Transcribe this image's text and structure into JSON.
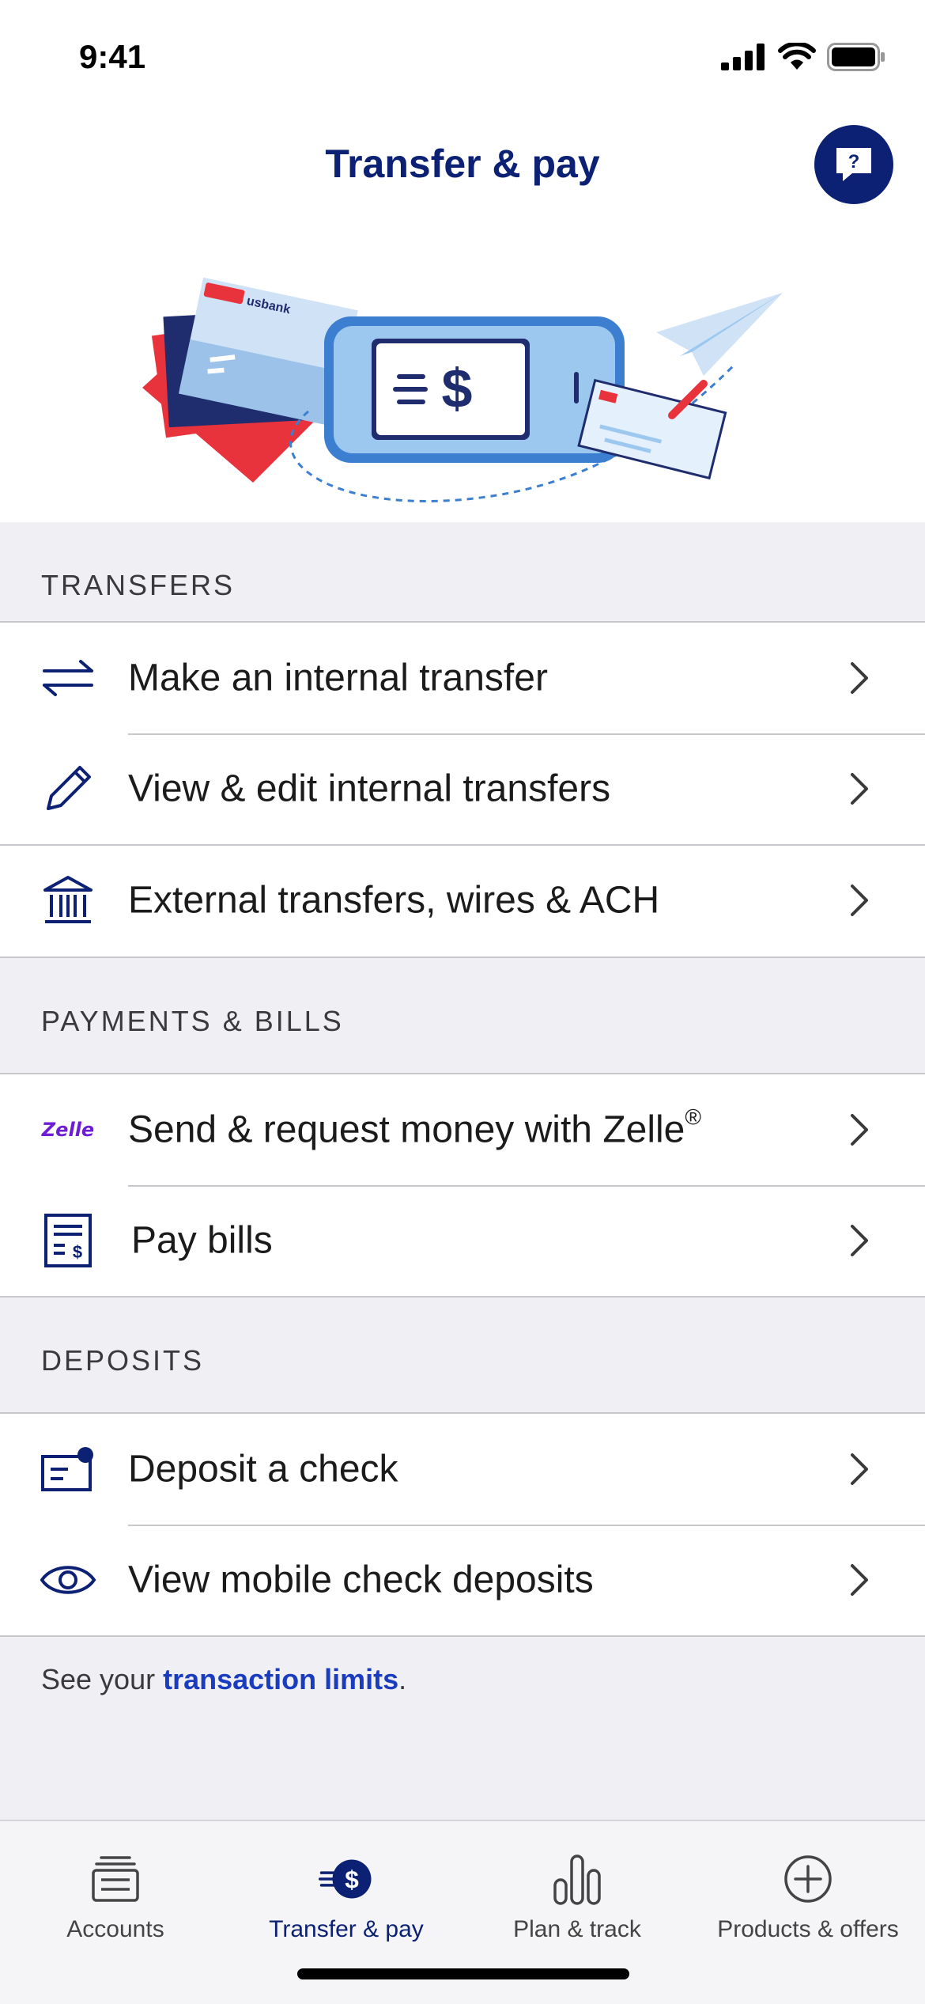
{
  "status_bar": {
    "time": "9:41"
  },
  "header": {
    "title": "Transfer & pay",
    "help_icon_text": "?"
  },
  "hero": {
    "card_brand": "usbank",
    "phone_symbol": "$"
  },
  "sections": {
    "transfers": {
      "title": "TRANSFERS",
      "items": [
        {
          "label": "Make an internal transfer",
          "icon": "transfer-arrows-icon"
        },
        {
          "label": "View & edit internal transfers",
          "icon": "pencil-icon"
        },
        {
          "label": "External transfers, wires & ACH",
          "icon": "bank-icon"
        }
      ]
    },
    "payments": {
      "title": "PAYMENTS & BILLS",
      "items": [
        {
          "label": "Send & request money with Zelle",
          "suffix": "®",
          "icon": "zelle-logo",
          "logo_text": "Zelle"
        },
        {
          "label": "Pay bills",
          "icon": "bill-icon"
        }
      ]
    },
    "deposits": {
      "title": "DEPOSITS",
      "items": [
        {
          "label": "Deposit a check",
          "icon": "check-deposit-icon"
        },
        {
          "label": "View mobile check deposits",
          "icon": "eye-icon"
        }
      ]
    }
  },
  "limits": {
    "prefix": "See your ",
    "link": "transaction limits",
    "suffix": "."
  },
  "tabbar": {
    "tabs": [
      {
        "label": "Accounts",
        "icon": "accounts-icon",
        "active": false
      },
      {
        "label": "Transfer & pay",
        "icon": "transfer-pay-icon",
        "active": true
      },
      {
        "label": "Plan & track",
        "icon": "bar-chart-icon",
        "active": false
      },
      {
        "label": "Products & offers",
        "icon": "plus-circle-icon",
        "active": false
      }
    ]
  },
  "colors": {
    "brand": "#0c2074",
    "link": "#1a3cbf",
    "zelle": "#6d1ed4",
    "accent_red": "#e8323c"
  }
}
